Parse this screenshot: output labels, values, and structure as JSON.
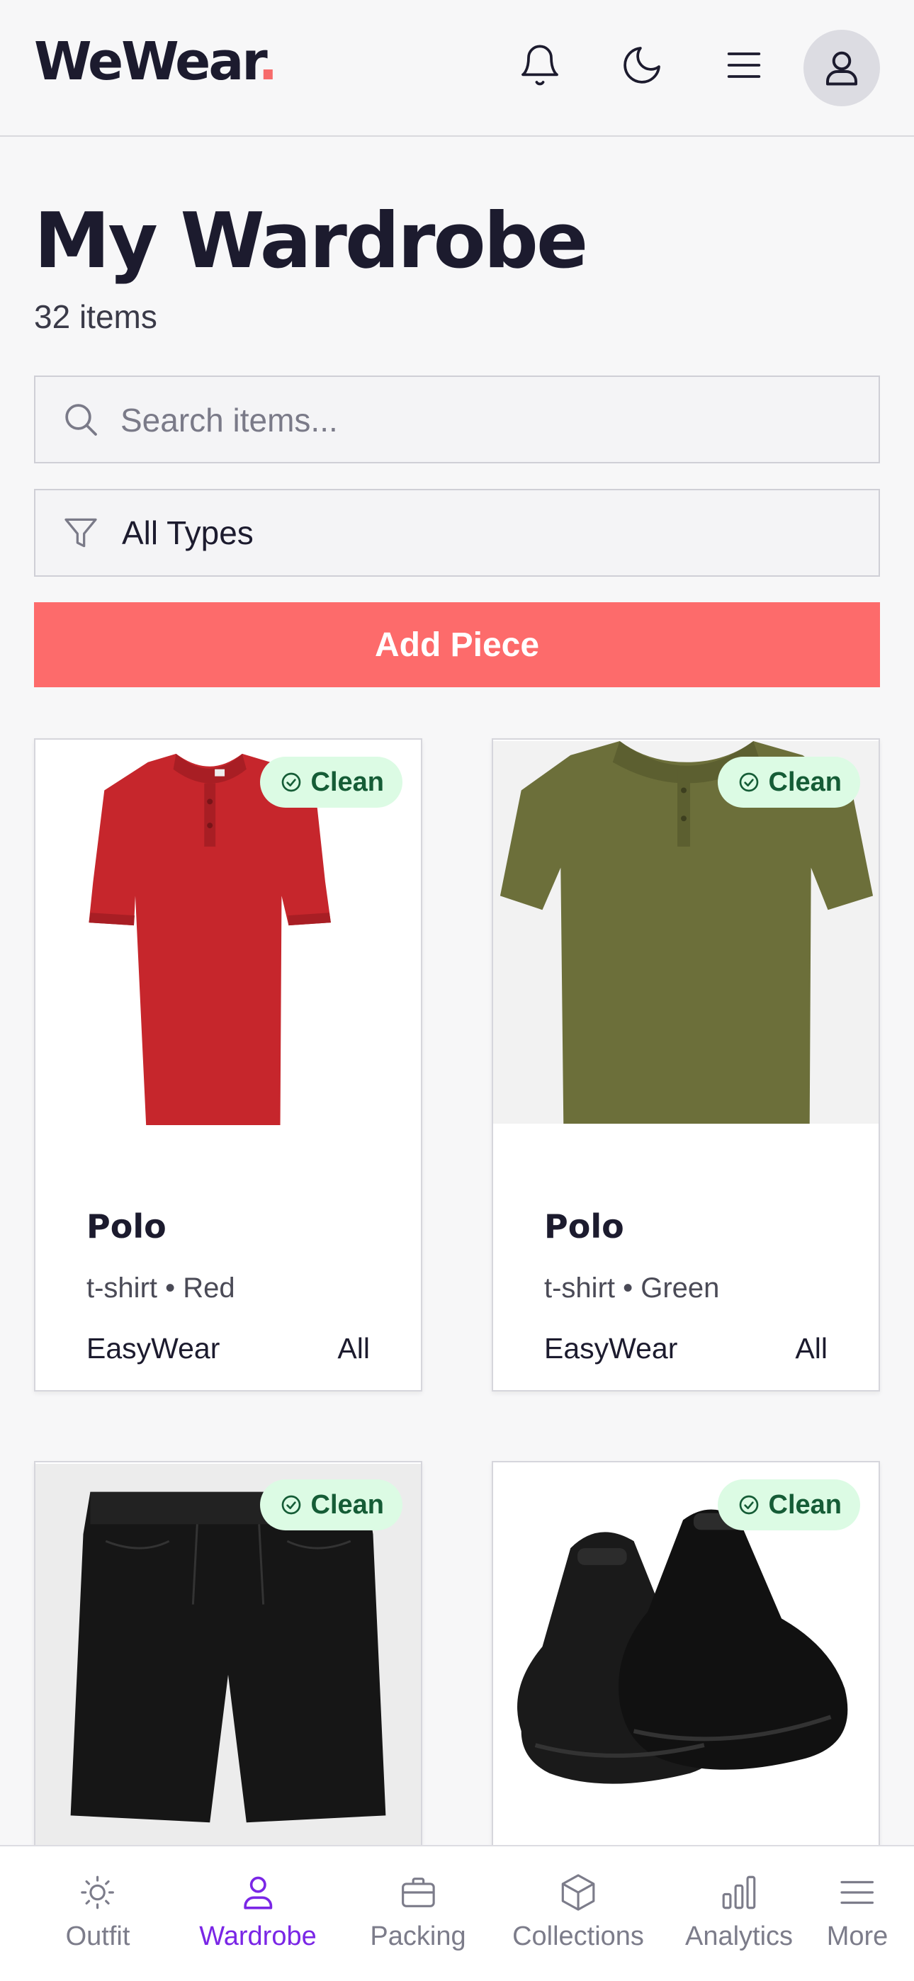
{
  "header": {
    "logo_text": "WeWear",
    "logo_dot": ".",
    "accent_color": "#f76b6b",
    "icons": [
      "bell-icon",
      "moon-icon",
      "menu-icon",
      "user-icon"
    ]
  },
  "page": {
    "title": "My Wardrobe",
    "count": "32 items"
  },
  "search": {
    "placeholder": "Search items..."
  },
  "filter": {
    "selected": "All Types"
  },
  "add_button": {
    "label": "Add Piece"
  },
  "items": [
    {
      "name": "Polo",
      "subtitle": "t-shirt • Red",
      "brand": "EasyWear",
      "season": "All",
      "status": "Clean",
      "image": "red polo shirt"
    },
    {
      "name": "Polo",
      "subtitle": "t-shirt • Green",
      "brand": "EasyWear",
      "season": "All",
      "status": "Clean",
      "image": "green polo shirt"
    },
    {
      "name": "",
      "subtitle": "",
      "brand": "",
      "season": "",
      "status": "Clean",
      "image": "black shorts"
    },
    {
      "name": "",
      "subtitle": "",
      "brand": "",
      "season": "",
      "status": "Clean",
      "image": "black sneakers"
    }
  ],
  "bottom_nav": [
    {
      "label": "Outfit",
      "icon": "sun-icon",
      "active": false
    },
    {
      "label": "Wardrobe",
      "icon": "person-icon",
      "active": true
    },
    {
      "label": "Packing",
      "icon": "briefcase-icon",
      "active": false
    },
    {
      "label": "Collections",
      "icon": "box-icon",
      "active": false
    },
    {
      "label": "Analytics",
      "icon": "bar-chart-icon",
      "active": false
    },
    {
      "label": "More",
      "icon": "menu-icon",
      "active": false
    }
  ],
  "colors": {
    "brand_coral": "#fd6b6b",
    "active_purple": "#7a26e6",
    "badge_bg": "#dcfbe4",
    "badge_text": "#155c36"
  }
}
